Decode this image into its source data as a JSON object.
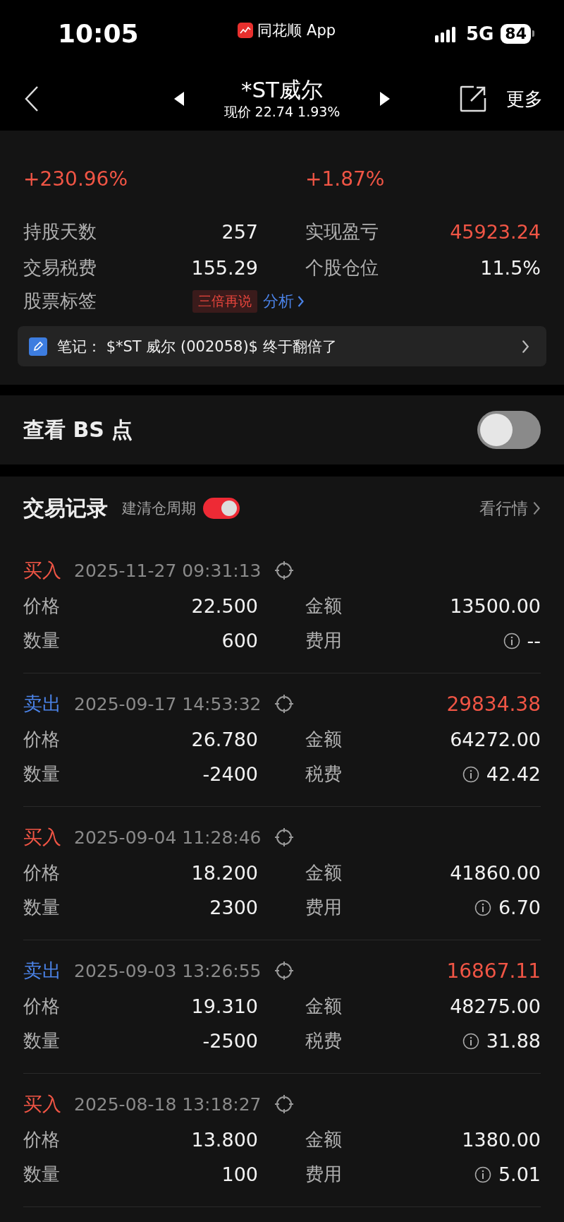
{
  "status_bar": {
    "time": "10:05",
    "app_label": "同花顺 App",
    "network": "5G",
    "battery": "84"
  },
  "header": {
    "title": "*ST威尔",
    "subtitle": "现价 22.74 1.93%",
    "more": "更多"
  },
  "summary": {
    "percents": [
      "+230.96%",
      "+1.87%"
    ],
    "stats": [
      {
        "label": "持股天数",
        "value": "257",
        "color": "#f2f2f2"
      },
      {
        "label": "实现盈亏",
        "value": "45923.24",
        "color": "#f05545"
      },
      {
        "label": "交易税费",
        "value": "155.29",
        "color": "#f2f2f2"
      },
      {
        "label": "个股仓位",
        "value": "11.5%",
        "color": "#f2f2f2"
      }
    ],
    "tags_label": "股票标签",
    "tag": "三倍再说",
    "analysis_link": "分析",
    "note": "笔记： $*ST 威尔 (002058)$ 终于翻倍了"
  },
  "bs_points": {
    "label": "查看 BS 点",
    "on": false
  },
  "trades": {
    "title": "交易记录",
    "cycle_label": "建清仓周期",
    "cycle_on": true,
    "market_link": "看行情",
    "records": [
      {
        "kind": "buy",
        "side": "买入",
        "time": "2025-11-27 09:31:13",
        "price_label": "价格",
        "price": "22.500",
        "amount_label": "金额",
        "amount": "13500.00",
        "qty_label": "数量",
        "qty": "600",
        "fee_label": "费用",
        "fee": "--"
      },
      {
        "kind": "sell",
        "side": "卖出",
        "time": "2025-09-17 14:53:32",
        "profit": "29834.38",
        "price_label": "价格",
        "price": "26.780",
        "amount_label": "金额",
        "amount": "64272.00",
        "qty_label": "数量",
        "qty": "-2400",
        "fee_label": "税费",
        "fee": "42.42"
      },
      {
        "kind": "buy",
        "side": "买入",
        "time": "2025-09-04 11:28:46",
        "price_label": "价格",
        "price": "18.200",
        "amount_label": "金额",
        "amount": "41860.00",
        "qty_label": "数量",
        "qty": "2300",
        "fee_label": "费用",
        "fee": "6.70"
      },
      {
        "kind": "sell",
        "side": "卖出",
        "time": "2025-09-03 13:26:55",
        "profit": "16867.11",
        "price_label": "价格",
        "price": "19.310",
        "amount_label": "金额",
        "amount": "48275.00",
        "qty_label": "数量",
        "qty": "-2500",
        "fee_label": "税费",
        "fee": "31.88"
      },
      {
        "kind": "buy",
        "side": "买入",
        "time": "2025-08-18 13:18:27",
        "price_label": "价格",
        "price": "13.800",
        "amount_label": "金额",
        "amount": "1380.00",
        "qty_label": "数量",
        "qty": "100",
        "fee_label": "费用",
        "fee": "5.01"
      }
    ]
  }
}
